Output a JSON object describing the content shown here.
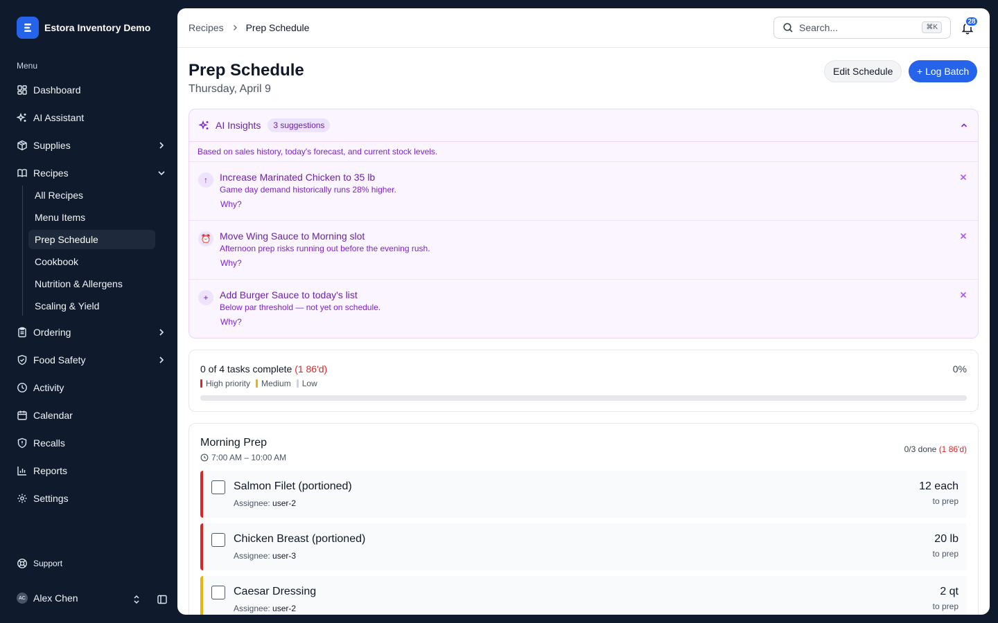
{
  "app": {
    "name": "Estora Inventory Demo"
  },
  "sidebar": {
    "menu_label": "Menu",
    "items": [
      {
        "label": "Dashboard",
        "icon": "dashboard-icon"
      },
      {
        "label": "AI Assistant",
        "icon": "sparkles-icon"
      },
      {
        "label": "Supplies",
        "icon": "box-icon"
      },
      {
        "label": "Recipes",
        "icon": "book-icon"
      },
      {
        "label": "Ordering",
        "icon": "clipboard-icon"
      },
      {
        "label": "Food Safety",
        "icon": "shield-icon"
      },
      {
        "label": "Activity",
        "icon": "clock-icon"
      },
      {
        "label": "Calendar",
        "icon": "calendar-icon"
      },
      {
        "label": "Recalls",
        "icon": "shield-alert-icon"
      },
      {
        "label": "Reports",
        "icon": "bar-chart-icon"
      },
      {
        "label": "Settings",
        "icon": "gear-icon"
      }
    ],
    "recipes_sub": [
      {
        "label": "All Recipes"
      },
      {
        "label": "Menu Items"
      },
      {
        "label": "Prep Schedule"
      },
      {
        "label": "Cookbook"
      },
      {
        "label": "Nutrition & Allergens"
      },
      {
        "label": "Scaling & Yield"
      }
    ],
    "active_sub": "Prep Schedule",
    "support": "Support",
    "user": {
      "initials": "AC",
      "name": "Alex Chen"
    }
  },
  "header": {
    "breadcrumbs": [
      "Recipes",
      "Prep Schedule"
    ],
    "search_placeholder": "Search...",
    "search_shortcut": "⌘K",
    "notification_count": "28"
  },
  "page": {
    "title": "Prep Schedule",
    "date": "Thursday, April 9",
    "edit_button": "Edit Schedule",
    "log_button": "+ Log Batch"
  },
  "insights": {
    "title": "AI Insights",
    "count_label": "3 suggestions",
    "basis": "Based on sales history, today's forecast, and current stock levels.",
    "why_label": "Why?",
    "suggestions": [
      {
        "icon": "arrow-up-icon",
        "glyph": "↑",
        "title": "Increase Marinated Chicken to 35 lb",
        "desc": "Game day demand historically runs 28% higher."
      },
      {
        "icon": "alarm-clock-icon",
        "glyph": "⏰",
        "title": "Move Wing Sauce to Morning slot",
        "desc": "Afternoon prep risks running out before the evening rush."
      },
      {
        "icon": "plus-icon",
        "glyph": "+",
        "title": "Add Burger Sauce to today's list",
        "desc": "Below par threshold — not yet on schedule."
      }
    ]
  },
  "progress": {
    "summary": "0 of 4 tasks complete",
    "overdue": "(1 86'd)",
    "percent_label": "0%",
    "percent": 0,
    "legend": [
      {
        "label": "High priority",
        "color": "#dc2626"
      },
      {
        "label": "Medium",
        "color": "#eab308"
      },
      {
        "label": "Low",
        "color": "#d1d5db"
      }
    ]
  },
  "morning_prep": {
    "title": "Morning Prep",
    "time": "7:00 AM – 10:00 AM",
    "done": "0/3 done",
    "overdue": "(1 86'd)",
    "assignee_label": "Assignee:",
    "qty_label": "to prep",
    "tasks": [
      {
        "name": "Salmon Filet (portioned)",
        "assignee": "user-2",
        "qty": "12 each",
        "color": "#dc2626"
      },
      {
        "name": "Chicken Breast (portioned)",
        "assignee": "user-3",
        "qty": "20 lb",
        "color": "#dc2626"
      },
      {
        "name": "Caesar Dressing",
        "assignee": "user-2",
        "qty": "2 qt",
        "color": "#eab308"
      }
    ]
  }
}
